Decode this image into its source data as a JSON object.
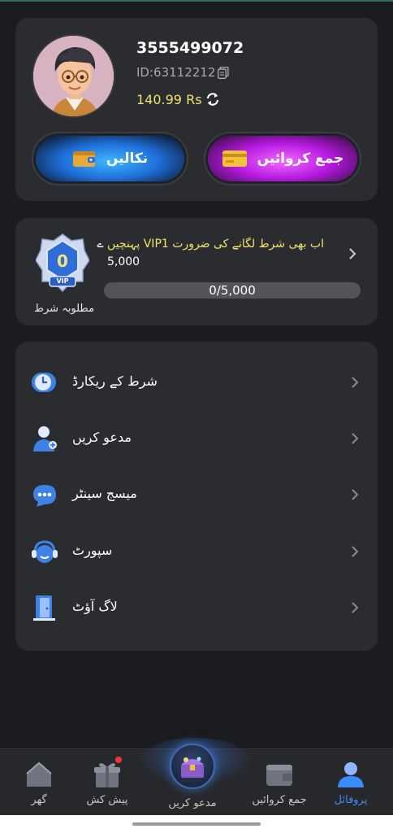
{
  "profile": {
    "username": "3555499072",
    "user_id": "ID:63112212",
    "balance": "140.99 Rs",
    "withdraw_label": "نکالیں",
    "deposit_label": "جمع کروائیں"
  },
  "vip": {
    "level_badge": "0",
    "badge_text": "VIP",
    "caption": "مطلوبہ شرط",
    "message": "اب بھی شرط لگانے کی ضرورت VIP1 پہنچیں",
    "message_suffix": "ے",
    "amount": "5,000",
    "progress_text": "0/5,000",
    "progress": 0
  },
  "menu": {
    "items": [
      {
        "label": "شرط کے ریکارڈ",
        "icon": "clock-icon"
      },
      {
        "label": "مدعو کریں",
        "icon": "invite-user-icon"
      },
      {
        "label": "میسج سینٹر",
        "icon": "message-icon"
      },
      {
        "label": "سپورٹ",
        "icon": "support-headset-icon"
      },
      {
        "label": "لاگ آؤٹ",
        "icon": "logout-door-icon"
      }
    ]
  },
  "nav": {
    "items": [
      {
        "label": "گھر",
        "icon": "home-icon"
      },
      {
        "label": "پیش کش",
        "icon": "gift-icon"
      },
      {
        "label": "مدعو کریں",
        "icon": "treasure-chest-icon"
      },
      {
        "label": "جمع کروائیں",
        "icon": "wallet-icon"
      },
      {
        "label": "پروفائل",
        "icon": "profile-icon"
      }
    ],
    "active_color": "#3d8cff"
  },
  "colors": {
    "background": "#1b1c1f",
    "card": "#2b2c30",
    "balance": "#f1e26b",
    "withdraw": "#1e6fd8",
    "deposit": "#b619e0"
  }
}
